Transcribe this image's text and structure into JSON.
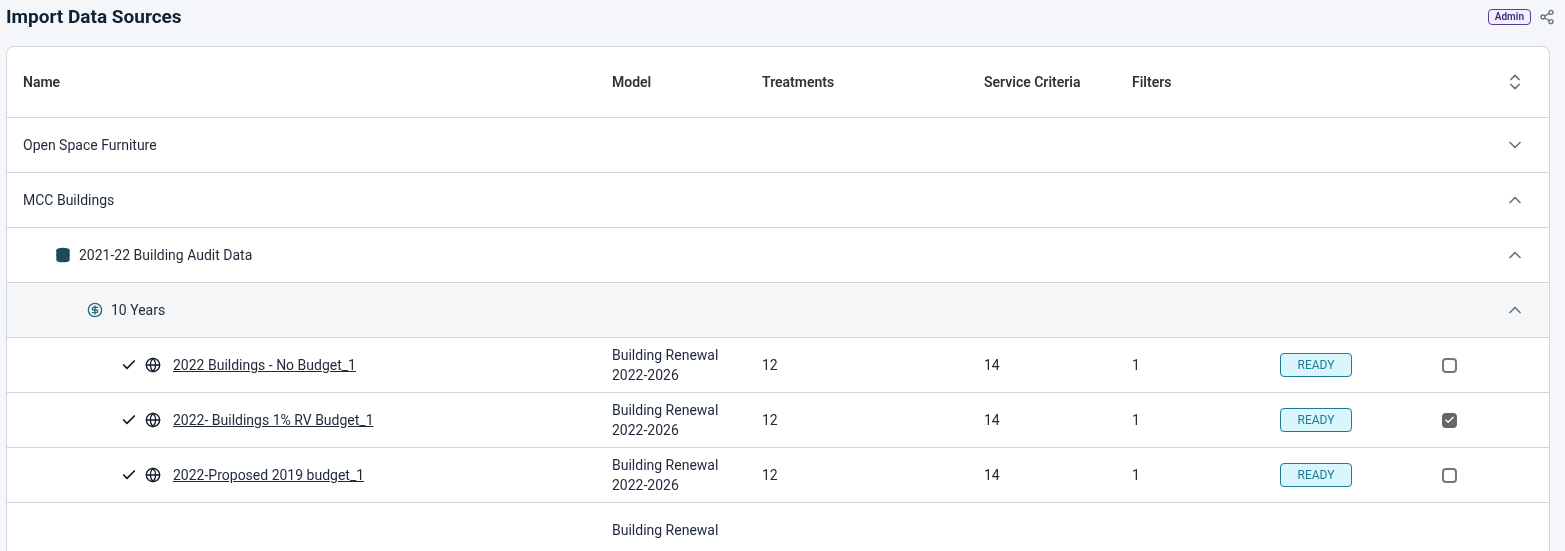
{
  "title": "Import Data Sources",
  "role_badge": "Admin",
  "table": {
    "columns": [
      "Name",
      "Model",
      "Treatments",
      "Service Criteria",
      "Filters"
    ],
    "rows": [
      {
        "kind": "group",
        "name": "Open Space Furniture",
        "expanded": false
      },
      {
        "kind": "group",
        "name": "MCC Buildings",
        "expanded": true,
        "children": [
          {
            "kind": "dataset",
            "name": "2021-22 Building Audit Data",
            "expanded": true,
            "children": [
              {
                "kind": "budget",
                "name": "10 Years",
                "expanded": true,
                "children": [
                  {
                    "kind": "scenario",
                    "name": "2022 Buildings - No Budget_1",
                    "done": true,
                    "model": [
                      "Building Renewal",
                      "2022-2026"
                    ],
                    "treatments": "12",
                    "service_criteria": "14",
                    "filters": "1",
                    "status": "READY",
                    "selected": false
                  },
                  {
                    "kind": "scenario",
                    "name": "2022- Buildings 1% RV Budget_1",
                    "done": true,
                    "model": [
                      "Building Renewal",
                      "2022-2026"
                    ],
                    "treatments": "12",
                    "service_criteria": "14",
                    "filters": "1",
                    "status": "READY",
                    "selected": true
                  },
                  {
                    "kind": "scenario",
                    "name": "2022-Proposed 2019 budget_1",
                    "done": true,
                    "model": [
                      "Building Renewal",
                      "2022-2026"
                    ],
                    "treatments": "12",
                    "service_criteria": "14",
                    "filters": "1",
                    "status": "READY",
                    "selected": false
                  },
                  {
                    "kind": "scenario",
                    "model": [
                      "Building Renewal"
                    ]
                  }
                ]
              }
            ]
          }
        ]
      }
    ]
  }
}
